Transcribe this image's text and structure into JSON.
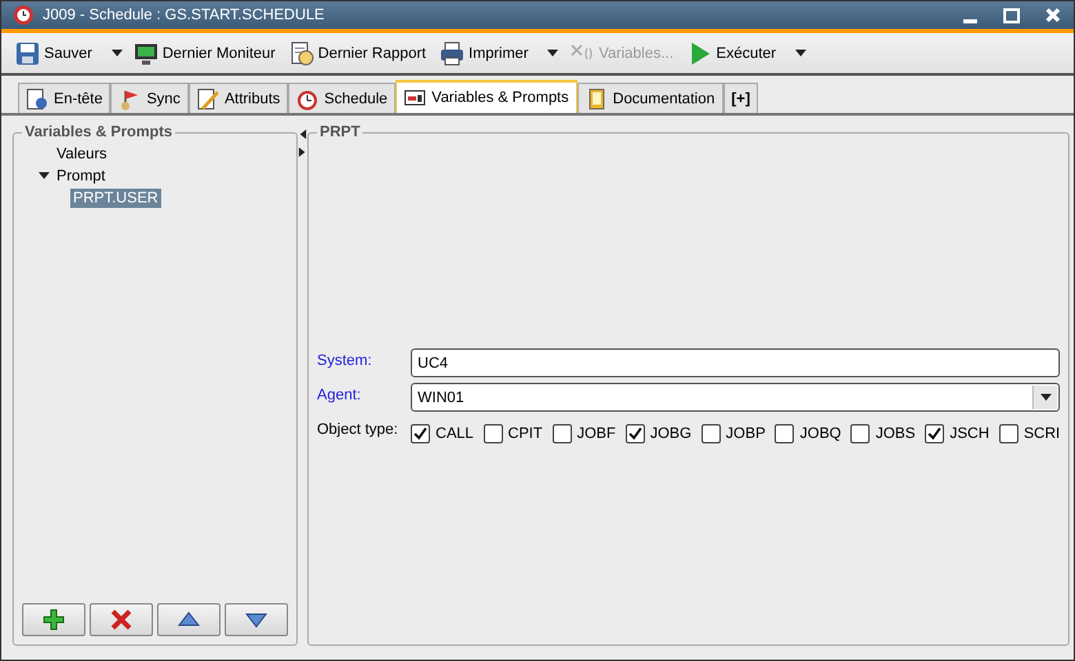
{
  "window": {
    "title": "J009 - Schedule : GS.START.SCHEDULE"
  },
  "toolbar": [
    {
      "kind": "save",
      "label": "Sauver",
      "disabled": false,
      "dropdown": true
    },
    {
      "kind": "monitor",
      "label": "Dernier Moniteur",
      "disabled": false
    },
    {
      "kind": "report",
      "label": "Dernier Rapport",
      "disabled": false
    },
    {
      "kind": "print",
      "label": "Imprimer",
      "disabled": false,
      "dropdown": true
    },
    {
      "kind": "variables",
      "label": "Variables...",
      "disabled": true
    },
    {
      "kind": "execute",
      "label": "Exécuter",
      "disabled": false,
      "dropdown": true
    }
  ],
  "tabs": [
    {
      "kind": "header",
      "label": "En-tête",
      "selected": false
    },
    {
      "kind": "sync",
      "label": "Sync",
      "selected": false
    },
    {
      "kind": "attributes",
      "label": "Attributs",
      "selected": false
    },
    {
      "kind": "schedule",
      "label": "Schedule",
      "selected": false
    },
    {
      "kind": "variables",
      "label": "Variables & Prompts",
      "selected": true
    },
    {
      "kind": "documentation",
      "label": "Documentation",
      "selected": false
    },
    {
      "kind": "add",
      "label": "[+]",
      "selected": false
    }
  ],
  "left_panel": {
    "title": "Variables & Prompts",
    "tree": [
      {
        "label": "Valeurs",
        "selected": false
      },
      {
        "label": "Prompt",
        "selected": false,
        "expanded": true,
        "children": [
          {
            "label": "PRPT.USER",
            "selected": true
          }
        ]
      }
    ],
    "buttons": [
      {
        "kind": "add"
      },
      {
        "kind": "delete"
      },
      {
        "kind": "up"
      },
      {
        "kind": "down"
      }
    ]
  },
  "right_panel": {
    "title": "PRPT",
    "fields": [
      {
        "kind": "text",
        "label": "System:",
        "value": "UC4"
      },
      {
        "kind": "select",
        "label": "Agent:",
        "value": "WIN01"
      }
    ],
    "object_type": {
      "label": "Object type:",
      "options": [
        {
          "label": "CALL",
          "checked": true
        },
        {
          "label": "CPIT",
          "checked": false
        },
        {
          "label": "JOBF",
          "checked": false
        },
        {
          "label": "JOBG",
          "checked": true
        },
        {
          "label": "JOBP",
          "checked": false
        },
        {
          "label": "JOBQ",
          "checked": false
        },
        {
          "label": "JOBS",
          "checked": false
        },
        {
          "label": "JSCH",
          "checked": true
        },
        {
          "label": "SCRI",
          "checked": false
        }
      ]
    }
  }
}
